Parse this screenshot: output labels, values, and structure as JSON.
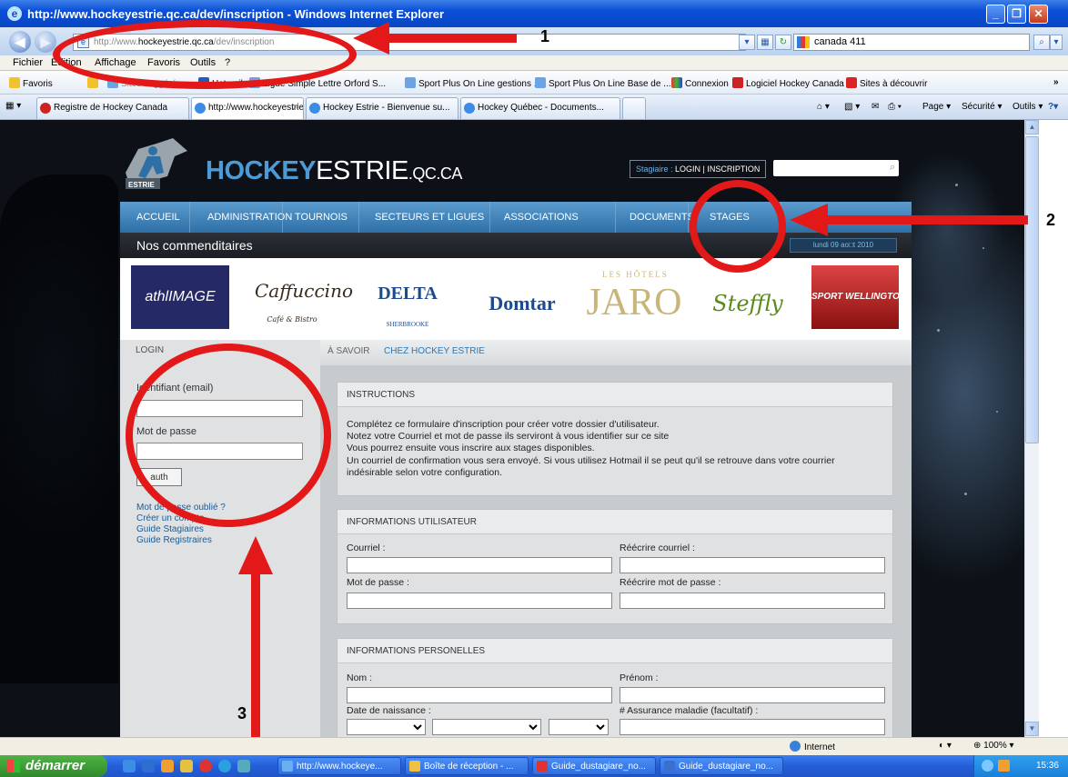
{
  "window": {
    "title": "http://www.hockeyestrie.qc.ca/dev/inscription - Windows Internet Explorer"
  },
  "addressbar": {
    "url_prefix": "http://www.",
    "url_domain": "hockeyestrie.qc.ca",
    "url_path": "/dev/inscription",
    "search_value": "canada 411"
  },
  "menu": [
    "Fichier",
    "Edition",
    "Affichage",
    "Favoris",
    "Outils",
    "?"
  ],
  "favorites": {
    "label": "Favoris",
    "items": [
      "Sites suggérés ▾",
      "Hotmail",
      "Ligue Simple Lettre Orford S...",
      "Sport Plus On Line gestions ...",
      "Sport Plus On Line Base de ...",
      "Connexion",
      "Logiciel Hockey Canada",
      "Sites à découvrir"
    ]
  },
  "tabs": [
    "Registre de Hockey Canada",
    "http://www.hockeyestrie...",
    "Hockey Estrie - Bienvenue su...",
    "Hockey Québec - Documents..."
  ],
  "commandbar": [
    "Page ▾",
    "Sécurité ▾",
    "Outils ▾"
  ],
  "site": {
    "logo_main_bold": "HOCKEY",
    "logo_main_rest": "ESTRIE",
    "logo_suffix": ".QC.CA",
    "logo_badge": "ESTRIE",
    "login_prefix": "Stagiaire :",
    "login_links": "LOGIN | INSCRIPTION",
    "nav": [
      "ACCUEIL",
      "ADMINISTRATION",
      "TOURNOIS",
      "SECTEURS ET LIGUES",
      "ASSOCIATIONS",
      "DOCUMENTS",
      "STAGES"
    ],
    "subheader": "Nos commenditaires",
    "date": "lundi 09 ao□t 2010",
    "sponsors": {
      "athl": "athlIMAGE",
      "caf": "Caffuccino",
      "caf_sub": "Café & Bistro",
      "delta": "DELTA",
      "delta_sub": "SHERBROOKE",
      "domtar": "Domtar",
      "jaro": "JARO",
      "jaro_top": "LES HÔTELS",
      "steffly": "Steffly",
      "well": "SPORT WELLINGTON"
    }
  },
  "login": {
    "title": "LOGIN",
    "id_label": "Identifiant (email)",
    "pw_label": "Mot de passe",
    "auth_button": "auth",
    "links": [
      "Mot de passe oublié ?",
      "Créer un compte",
      "Guide Stagiaires",
      "Guide Registraires"
    ]
  },
  "breadcrumb": {
    "prefix": "À SAVOIR",
    "link": "CHEZ HOCKEY ESTRIE"
  },
  "instructions": {
    "title": "INSTRUCTIONS",
    "lines": [
      "Complétez ce formulaire d'inscription pour créer votre dossier d'utilisateur.",
      "Notez votre Courriel et mot de passe ils serviront à vous identifier sur ce site",
      "Vous pourrez ensuite vous inscrire aux stages disponibles.",
      "Un courriel de confirmation vous sera envoyé. Si vous utilisez Hotmail il se peut qu'il se retrouve dans votre courrier",
      "indésirable selon votre configuration."
    ]
  },
  "user_info": {
    "title": "INFORMATIONS UTILISATEUR",
    "email": "Courriel :",
    "email_confirm": "Réécrire courriel :",
    "password": "Mot de passe :",
    "password_confirm": "Réécrire mot de passe :"
  },
  "personal_info": {
    "title": "INFORMATIONS PERSONELLES",
    "lastname": "Nom :",
    "firstname": "Prénom :",
    "birthdate": "Date de naissance :",
    "health": "# Assurance maladie (facultatif) :"
  },
  "annotations": [
    "1",
    "2",
    "3"
  ],
  "status": {
    "zone": "Internet",
    "zoom": "100%"
  },
  "taskbar": {
    "start": "démarrer",
    "items": [
      "http://www.hockeye...",
      "Boîte de réception - ...",
      "Guide_dustagiare_no...",
      "Guide_dustagiare_no..."
    ],
    "clock": "15:36"
  },
  "colors": {
    "annotation_red": "#e31818",
    "nav_blue": "#2e6fa6",
    "logo_blue": "#4d9bd6"
  }
}
